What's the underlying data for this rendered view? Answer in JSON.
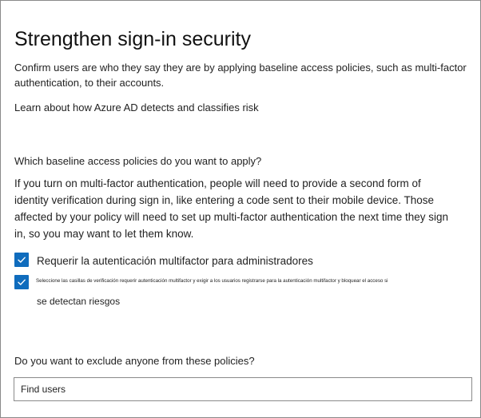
{
  "page": {
    "title": "Strengthen sign-in security",
    "intro": "Confirm users are who they say they are by applying baseline access policies, such as multi-factor authentication, to their accounts.",
    "learn_link": "Learn about how Azure AD detects and classifies risk"
  },
  "policies": {
    "question": "Which baseline access policies do you want to apply?",
    "mfa_info": "If you turn on multi-factor authentication, people will need to provide a second form of identity verification during sign in, like entering a code sent to their mobile device. Those affected by your policy will need to set up multi-factor authentication the next time they sign in, so you may want to let them know.",
    "options": [
      {
        "label": "Requerir la autenticación multifactor para administradores",
        "checked": true
      },
      {
        "label_small": "Seleccione las casillas de verificación requerir autenticación multifactor y exigir a los usuarios registrarse para la autenticación multifactor y bloquear el acceso si",
        "label_big": "se detectan riesgos",
        "checked": true
      }
    ]
  },
  "exclude": {
    "question": "Do you want to exclude anyone from these policies?",
    "search_placeholder": "Find users"
  },
  "colors": {
    "checkbox_fill": "#0f6cbd",
    "border": "#8a8a8a"
  },
  "icons": {
    "checkbox_checked": "checkmark-icon"
  }
}
